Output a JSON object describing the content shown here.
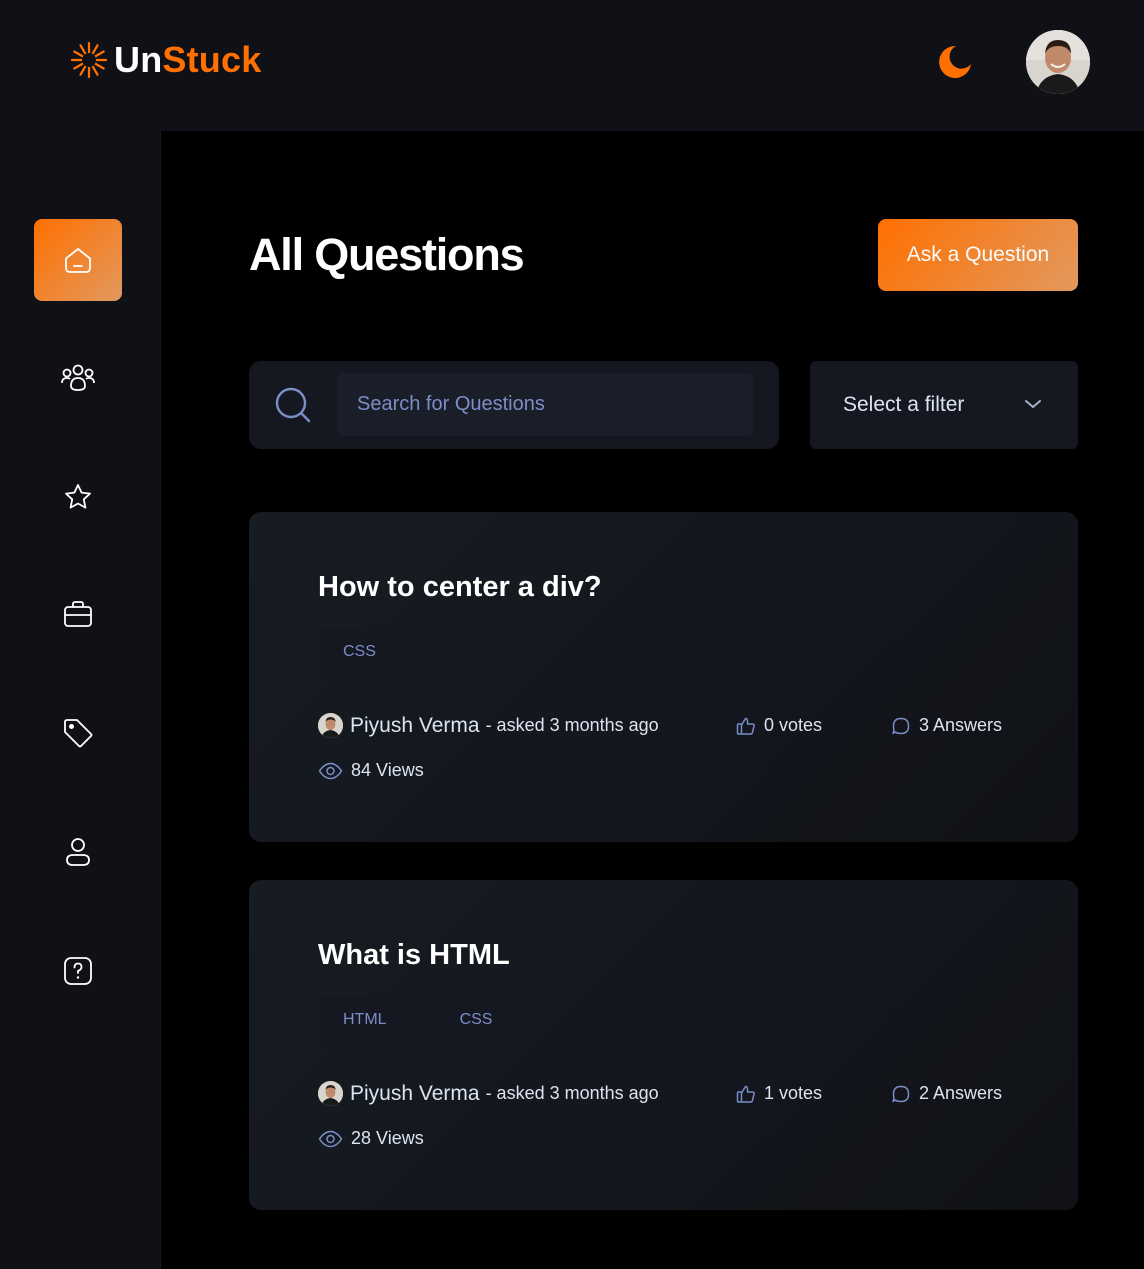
{
  "brand": {
    "name_part1": "Un",
    "name_part2": "Stuck"
  },
  "header": {
    "theme_icon": "moon-icon",
    "avatar_icon": "user-avatar"
  },
  "sidebar": {
    "items": [
      {
        "name": "home",
        "icon": "home-icon",
        "active": true
      },
      {
        "name": "community",
        "icon": "users-icon",
        "active": false
      },
      {
        "name": "collections",
        "icon": "star-icon",
        "active": false
      },
      {
        "name": "jobs",
        "icon": "briefcase-icon",
        "active": false
      },
      {
        "name": "tags",
        "icon": "tag-icon",
        "active": false
      },
      {
        "name": "profile",
        "icon": "user-icon",
        "active": false
      },
      {
        "name": "ask-question",
        "icon": "question-icon",
        "active": false
      }
    ]
  },
  "main": {
    "title": "All Questions",
    "ask_button": "Ask a Question",
    "search_placeholder": "Search for Questions",
    "filter_label": "Select a filter"
  },
  "questions": [
    {
      "title": "How to center a div?",
      "tags": [
        "CSS"
      ],
      "author": "Piyush Verma",
      "asked": "- asked 3 months ago",
      "votes": "0 votes",
      "answers": "3 Answers",
      "views": "84 Views"
    },
    {
      "title": "What is HTML",
      "tags": [
        "HTML",
        "CSS"
      ],
      "author": "Piyush Verma",
      "asked": "- asked 3 months ago",
      "votes": "1 votes",
      "answers": "2 Answers",
      "views": "28 Views"
    }
  ],
  "colors": {
    "accent": "#ff7000",
    "accent_light": "#e2995f",
    "panel": "#0f1117",
    "card": "#151821",
    "tag_text": "#7b8ec8"
  }
}
